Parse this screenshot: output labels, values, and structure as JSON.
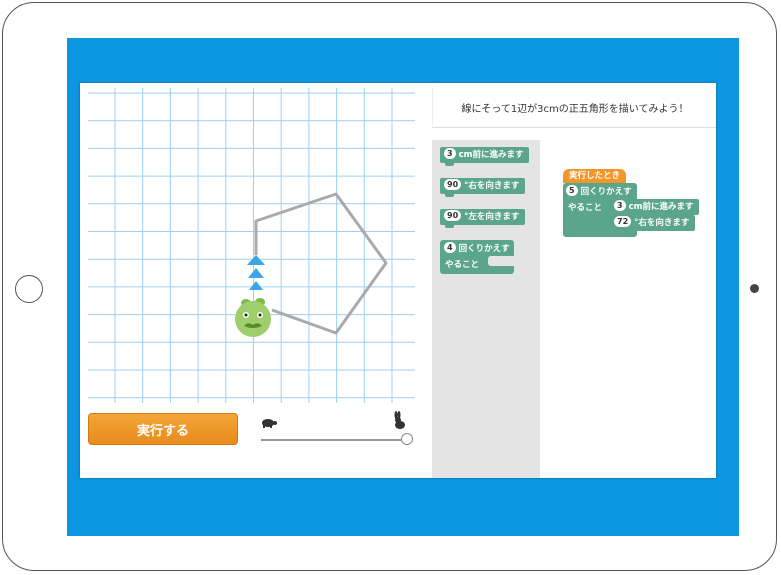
{
  "instruction": "線にそって1辺が3cmの正五角形を描いてみよう！",
  "run_button": "実行する",
  "speed": {
    "value": 1.0,
    "slow_icon": "turtle-icon",
    "fast_icon": "rabbit-icon"
  },
  "character": "green-bug-icon",
  "palette": {
    "forward": {
      "num": "3",
      "label": "cm前に進みます"
    },
    "turn_right": {
      "num": "90",
      "label": "°右を向きます"
    },
    "turn_left": {
      "num": "90",
      "label": "°左を向きます"
    },
    "repeat": {
      "num": "4",
      "label": "回くりかえす",
      "do_label": "やること"
    }
  },
  "program": {
    "event": "実行したとき",
    "repeat": {
      "num": "5",
      "label": "回くりかえす",
      "do_label": "やること"
    },
    "forward": {
      "num": "3",
      "label": "cm前に進みます"
    },
    "turn": {
      "num": "72",
      "label": "°右を向きます"
    }
  },
  "colors": {
    "background": "#0d96e0",
    "grid": "#9dd0f2",
    "block": "#5ba58c",
    "event": "#f0962a",
    "run": "#ec9626"
  }
}
